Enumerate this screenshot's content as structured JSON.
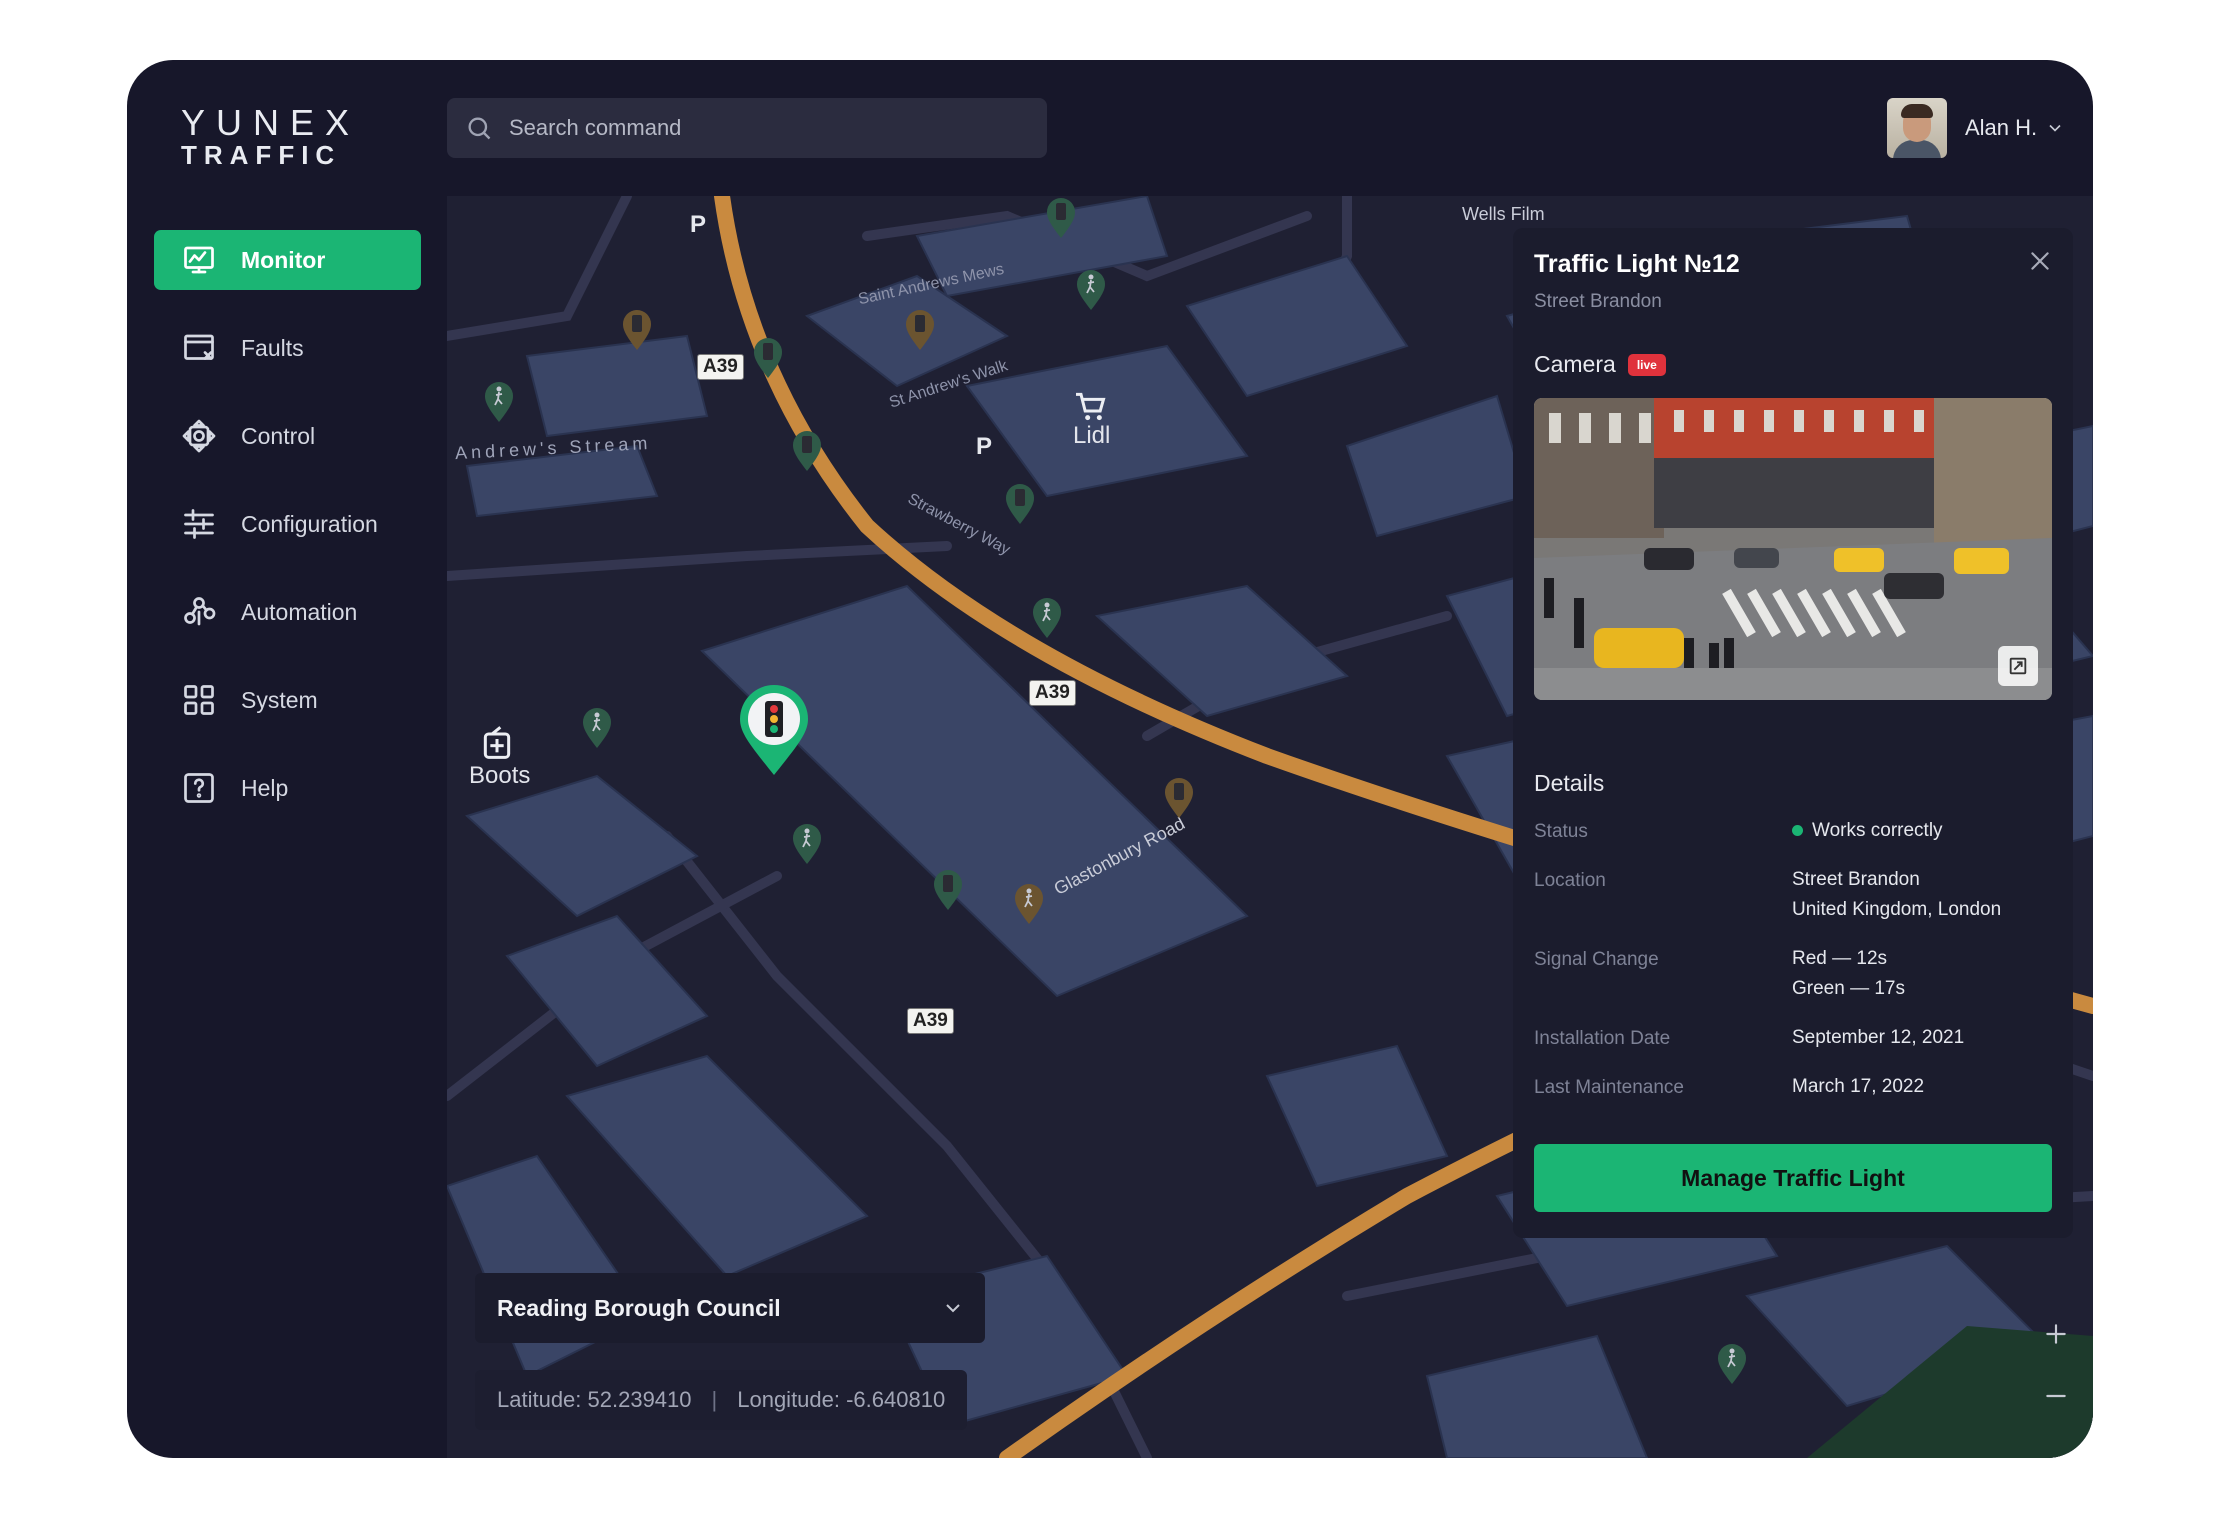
{
  "logo": {
    "line1": "YUNEX",
    "line2": "TRAFFIC"
  },
  "search": {
    "placeholder": "Search command"
  },
  "user": {
    "name": "Alan H."
  },
  "sidebar": {
    "items": [
      {
        "label": "Monitor",
        "icon": "monitor-icon",
        "active": true
      },
      {
        "label": "Faults",
        "icon": "faults-icon"
      },
      {
        "label": "Control",
        "icon": "control-icon"
      },
      {
        "label": "Configuration",
        "icon": "sliders-icon"
      },
      {
        "label": "Automation",
        "icon": "automation-icon"
      },
      {
        "label": "System",
        "icon": "grid-icon"
      },
      {
        "label": "Help",
        "icon": "help-icon"
      }
    ]
  },
  "map": {
    "road_labels": [
      "A39",
      "A39",
      "A39"
    ],
    "streets": [
      "Andrew's Stream",
      "St Andrew's Walk",
      "Saint Andrews Mews",
      "Strawberry Way",
      "Glastonbury Road",
      "Wells Film"
    ],
    "pois": [
      "Lidl",
      "Boots"
    ],
    "region": "Reading Borough Council",
    "latitude": "Latitude: 52.239410",
    "longitude": "Longitude: -6.640810"
  },
  "panel": {
    "title": "Traffic Light №12",
    "subtitle": "Street Brandon",
    "camera_label": "Camera",
    "live_badge": "live",
    "details_heading": "Details",
    "status_label": "Status",
    "status_value": "Works correctly",
    "location_label": "Location",
    "location_line1": "Street Brandon",
    "location_line2": "United Kingdom, London",
    "signal_label": "Signal Change",
    "signal_red": "Red — 12s",
    "signal_green": "Green — 17s",
    "install_label": "Installation Date",
    "install_value": "September 12, 2021",
    "maint_label": "Last Maintenance",
    "maint_value": "March 17, 2022",
    "manage_button": "Manage Traffic Light"
  },
  "colors": {
    "accent": "#1bb574",
    "background": "#17172a",
    "live": "#e0323c"
  }
}
